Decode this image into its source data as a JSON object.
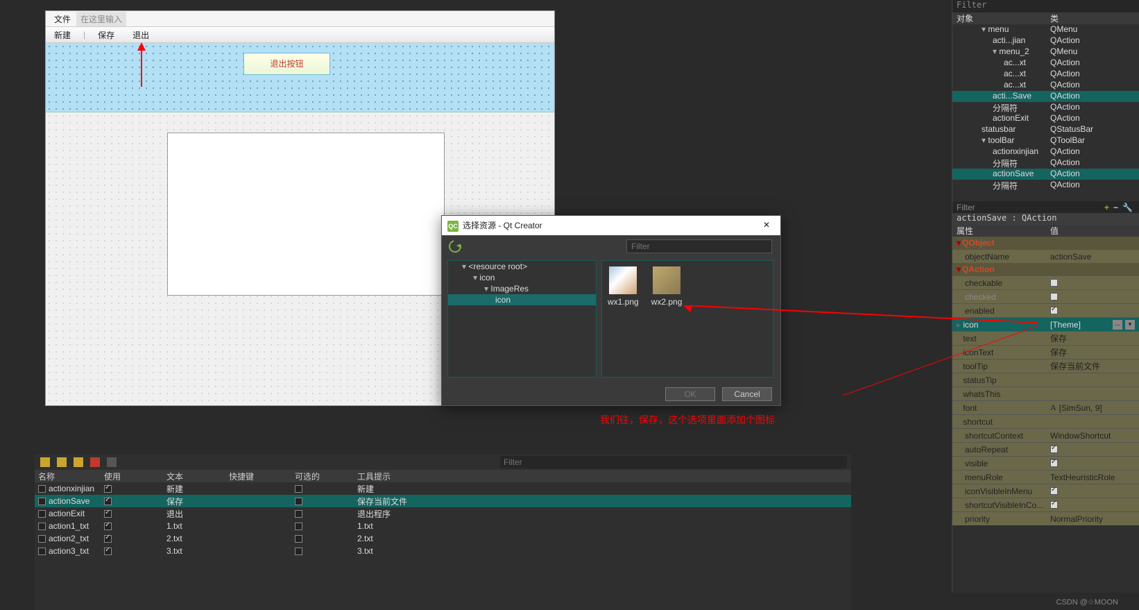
{
  "form": {
    "menu_file": "文件",
    "menu_typehere": "在这里输入",
    "tb_new": "新建",
    "tb_save": "保存",
    "tb_exit": "退出",
    "exit_btn": "退出按钮"
  },
  "dialog": {
    "title": "选择资源 - Qt Creator",
    "filter_ph": "Filter",
    "tree": {
      "root": "<resource root>",
      "n1": "icon",
      "n2": "ImageRes",
      "n3": "icon"
    },
    "thumbs": {
      "t1": "wx1.png",
      "t2": "wx2.png"
    },
    "ok": "OK",
    "cancel": "Cancel"
  },
  "annotation": "我们往，保存，这个选项里面添加个图标",
  "actionPanel": {
    "filter_ph": "Filter",
    "headers": {
      "name": "名称",
      "use": "使用",
      "text": "文本",
      "shortcut": "快捷键",
      "checkable": "可选的",
      "tooltip": "工具提示"
    },
    "rows": [
      {
        "name": "actionxinjian",
        "use": true,
        "text": "新建",
        "checkable": false,
        "tooltip": "新建"
      },
      {
        "name": "actionSave",
        "use": true,
        "text": "保存",
        "checkable": false,
        "tooltip": "保存当前文件",
        "sel": true
      },
      {
        "name": "actionExit",
        "use": true,
        "text": "退出",
        "checkable": false,
        "tooltip": "退出程序"
      },
      {
        "name": "action1_txt",
        "use": true,
        "text": "1.txt",
        "checkable": false,
        "tooltip": "1.txt"
      },
      {
        "name": "action2_txt",
        "use": true,
        "text": "2.txt",
        "checkable": false,
        "tooltip": "2.txt"
      },
      {
        "name": "action3_txt",
        "use": true,
        "text": "3.txt",
        "checkable": false,
        "tooltip": "3.txt"
      }
    ]
  },
  "objInspector": {
    "filter_ph": "Filter",
    "h_obj": "对象",
    "h_cls": "类",
    "rows": [
      {
        "o": "menu",
        "c": "QMenu",
        "ind": 1,
        "tri": "d"
      },
      {
        "o": "acti...jian",
        "c": "QAction",
        "ind": 2
      },
      {
        "o": "menu_2",
        "c": "QMenu",
        "ind": 2,
        "tri": "d"
      },
      {
        "o": "ac...xt",
        "c": "QAction",
        "ind": 3
      },
      {
        "o": "ac...xt",
        "c": "QAction",
        "ind": 3
      },
      {
        "o": "ac...xt",
        "c": "QAction",
        "ind": 3
      },
      {
        "o": "acti...Save",
        "c": "QAction",
        "ind": 2,
        "sel": true
      },
      {
        "o": "分隔符",
        "c": "QAction",
        "ind": 2
      },
      {
        "o": "actionExit",
        "c": "QAction",
        "ind": 2
      },
      {
        "o": "statusbar",
        "c": "QStatusBar",
        "ind": 1
      },
      {
        "o": "toolBar",
        "c": "QToolBar",
        "ind": 1,
        "tri": "d"
      },
      {
        "o": "actionxinjian",
        "c": "QAction",
        "ind": 2
      },
      {
        "o": "分隔符",
        "c": "QAction",
        "ind": 2
      },
      {
        "o": "actionSave",
        "c": "QAction",
        "ind": 2,
        "sel": true
      },
      {
        "o": "分隔符",
        "c": "QAction",
        "ind": 2
      }
    ]
  },
  "propEditor": {
    "filter_ph": "Filter",
    "title": "actionSave : QAction",
    "h_prop": "属性",
    "h_val": "值",
    "groups": [
      {
        "name": "QObject",
        "rows": [
          {
            "k": "objectName",
            "v": "actionSave"
          }
        ]
      },
      {
        "name": "QAction",
        "rows": [
          {
            "k": "checkable",
            "chk": false
          },
          {
            "k": "checked",
            "chk": false,
            "dim": true
          },
          {
            "k": "enabled",
            "chk": true
          },
          {
            "k": "icon",
            "v": "[Theme]",
            "sel": true,
            "exp": true,
            "dots": true,
            "dd": true
          },
          {
            "k": "text",
            "v": "保存",
            "exp": true
          },
          {
            "k": "iconText",
            "v": "保存",
            "exp": true
          },
          {
            "k": "toolTip",
            "v": "保存当前文件",
            "exp": true
          },
          {
            "k": "statusTip",
            "v": "",
            "exp": true
          },
          {
            "k": "whatsThis",
            "v": "",
            "exp": true
          },
          {
            "k": "font",
            "v": "[SimSun, 9]",
            "exp": true,
            "fontico": true
          },
          {
            "k": "shortcut",
            "v": "",
            "exp": true
          },
          {
            "k": "shortcutContext",
            "v": "WindowShortcut"
          },
          {
            "k": "autoRepeat",
            "chk": true
          },
          {
            "k": "visible",
            "chk": true
          },
          {
            "k": "menuRole",
            "v": "TextHeuristicRole"
          },
          {
            "k": "iconVisibleInMenu",
            "chk": true
          },
          {
            "k": "shortcutVisibleInCo...",
            "chk": true
          },
          {
            "k": "priority",
            "v": "NormalPriority"
          }
        ]
      }
    ]
  },
  "watermark": "CSDN @☆MOON"
}
